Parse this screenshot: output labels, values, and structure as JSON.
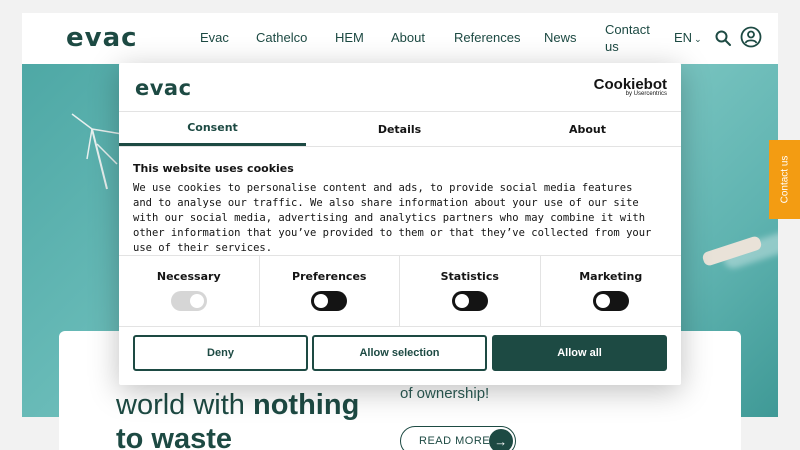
{
  "header": {
    "logo": "evac",
    "nav": [
      "Evac",
      "Cathelco",
      "HEM",
      "About",
      "References",
      "News"
    ],
    "contact": "Contact us",
    "lang": "EN"
  },
  "side_tab": {
    "label": "Contact us"
  },
  "hero": {
    "headline_line1": "world with ",
    "headline_bold1": "nothing",
    "headline_line2": "to waste",
    "ownership": "of ownership!",
    "read_more": "READ MORE"
  },
  "dialog": {
    "logo": "evac",
    "cookiebot_name": "Cookiebot",
    "cookiebot_by": "by Usercentrics",
    "tabs": [
      "Consent",
      "Details",
      "About"
    ],
    "title": "This website uses cookies",
    "body": "We use cookies to personalise content and ads, to provide social media features and to analyse our traffic. We also share information about your use of our site with our social media, advertising and analytics partners who may combine it with other information that you’ve provided to them or that they’ve collected from your use of their services.",
    "toggles": [
      "Necessary",
      "Preferences",
      "Statistics",
      "Marketing"
    ],
    "buttons": {
      "deny": "Deny",
      "allow_selection": "Allow selection",
      "allow_all": "Allow all"
    }
  },
  "colors": {
    "brand": "#1d4a43",
    "accent_orange": "#f39c12",
    "sea": "#66b9b6"
  }
}
